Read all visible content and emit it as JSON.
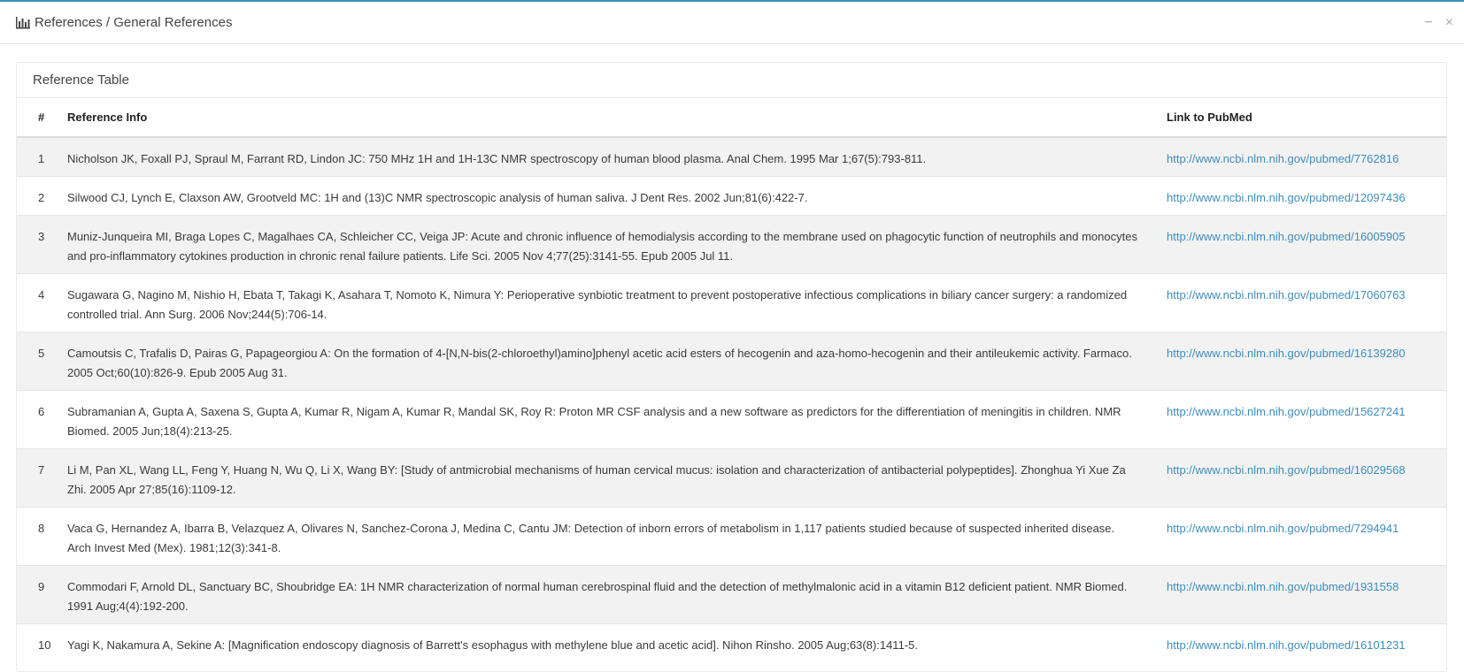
{
  "window": {
    "title": "References / General References",
    "minimize_icon": "minus-icon",
    "close_icon": "close-icon",
    "minimize_glyph": "−",
    "close_glyph": "×",
    "accent_color": "#3c8dbc"
  },
  "box": {
    "title": "Reference Table"
  },
  "table": {
    "headers": {
      "num": "#",
      "ref": "Reference Info",
      "link": "Link to PubMed"
    },
    "rows": [
      {
        "num": "1",
        "ref": "Nicholson JK, Foxall PJ, Spraul M, Farrant RD, Lindon JC: 750 MHz 1H and 1H-13C NMR spectroscopy of human blood plasma. Anal Chem. 1995 Mar 1;67(5):793-811.",
        "link": "http://www.ncbi.nlm.nih.gov/pubmed/7762816"
      },
      {
        "num": "2",
        "ref": "Silwood CJ, Lynch E, Claxson AW, Grootveld MC: 1H and (13)C NMR spectroscopic analysis of human saliva. J Dent Res. 2002 Jun;81(6):422-7.",
        "link": "http://www.ncbi.nlm.nih.gov/pubmed/12097436"
      },
      {
        "num": "3",
        "ref": "Muniz-Junqueira MI, Braga Lopes C, Magalhaes CA, Schleicher CC, Veiga JP: Acute and chronic influence of hemodialysis according to the membrane used on phagocytic function of neutrophils and monocytes and pro-inflammatory cytokines production in chronic renal failure patients. Life Sci. 2005 Nov 4;77(25):3141-55. Epub 2005 Jul 11.",
        "link": "http://www.ncbi.nlm.nih.gov/pubmed/16005905"
      },
      {
        "num": "4",
        "ref": "Sugawara G, Nagino M, Nishio H, Ebata T, Takagi K, Asahara T, Nomoto K, Nimura Y: Perioperative synbiotic treatment to prevent postoperative infectious complications in biliary cancer surgery: a randomized controlled trial. Ann Surg. 2006 Nov;244(5):706-14.",
        "link": "http://www.ncbi.nlm.nih.gov/pubmed/17060763"
      },
      {
        "num": "5",
        "ref": "Camoutsis C, Trafalis D, Pairas G, Papageorgiou A: On the formation of 4-[N,N-bis(2-chloroethyl)amino]phenyl acetic acid esters of hecogenin and aza-homo-hecogenin and their antileukemic activity. Farmaco. 2005 Oct;60(10):826-9. Epub 2005 Aug 31.",
        "link": "http://www.ncbi.nlm.nih.gov/pubmed/16139280"
      },
      {
        "num": "6",
        "ref": "Subramanian A, Gupta A, Saxena S, Gupta A, Kumar R, Nigam A, Kumar R, Mandal SK, Roy R: Proton MR CSF analysis and a new software as predictors for the differentiation of meningitis in children. NMR Biomed. 2005 Jun;18(4):213-25.",
        "link": "http://www.ncbi.nlm.nih.gov/pubmed/15627241"
      },
      {
        "num": "7",
        "ref": "Li M, Pan XL, Wang LL, Feng Y, Huang N, Wu Q, Li X, Wang BY: [Study of antmicrobial mechanisms of human cervical mucus: isolation and characterization of antibacterial polypeptides]. Zhonghua Yi Xue Za Zhi. 2005 Apr 27;85(16):1109-12.",
        "link": "http://www.ncbi.nlm.nih.gov/pubmed/16029568"
      },
      {
        "num": "8",
        "ref": "Vaca G, Hernandez A, Ibarra B, Velazquez A, Olivares N, Sanchez-Corona J, Medina C, Cantu JM: Detection of inborn errors of metabolism in 1,117 patients studied because of suspected inherited disease. Arch Invest Med (Mex). 1981;12(3):341-8.",
        "link": "http://www.ncbi.nlm.nih.gov/pubmed/7294941"
      },
      {
        "num": "9",
        "ref": "Commodari F, Arnold DL, Sanctuary BC, Shoubridge EA: 1H NMR characterization of normal human cerebrospinal fluid and the detection of methylmalonic acid in a vitamin B12 deficient patient. NMR Biomed. 1991 Aug;4(4):192-200.",
        "link": "http://www.ncbi.nlm.nih.gov/pubmed/1931558"
      },
      {
        "num": "10",
        "ref": "Yagi K, Nakamura A, Sekine A: [Magnification endoscopy diagnosis of Barrett's esophagus with methylene blue and acetic acid]. Nihon Rinsho. 2005 Aug;63(8):1411-5.",
        "link": "http://www.ncbi.nlm.nih.gov/pubmed/16101231"
      }
    ]
  }
}
